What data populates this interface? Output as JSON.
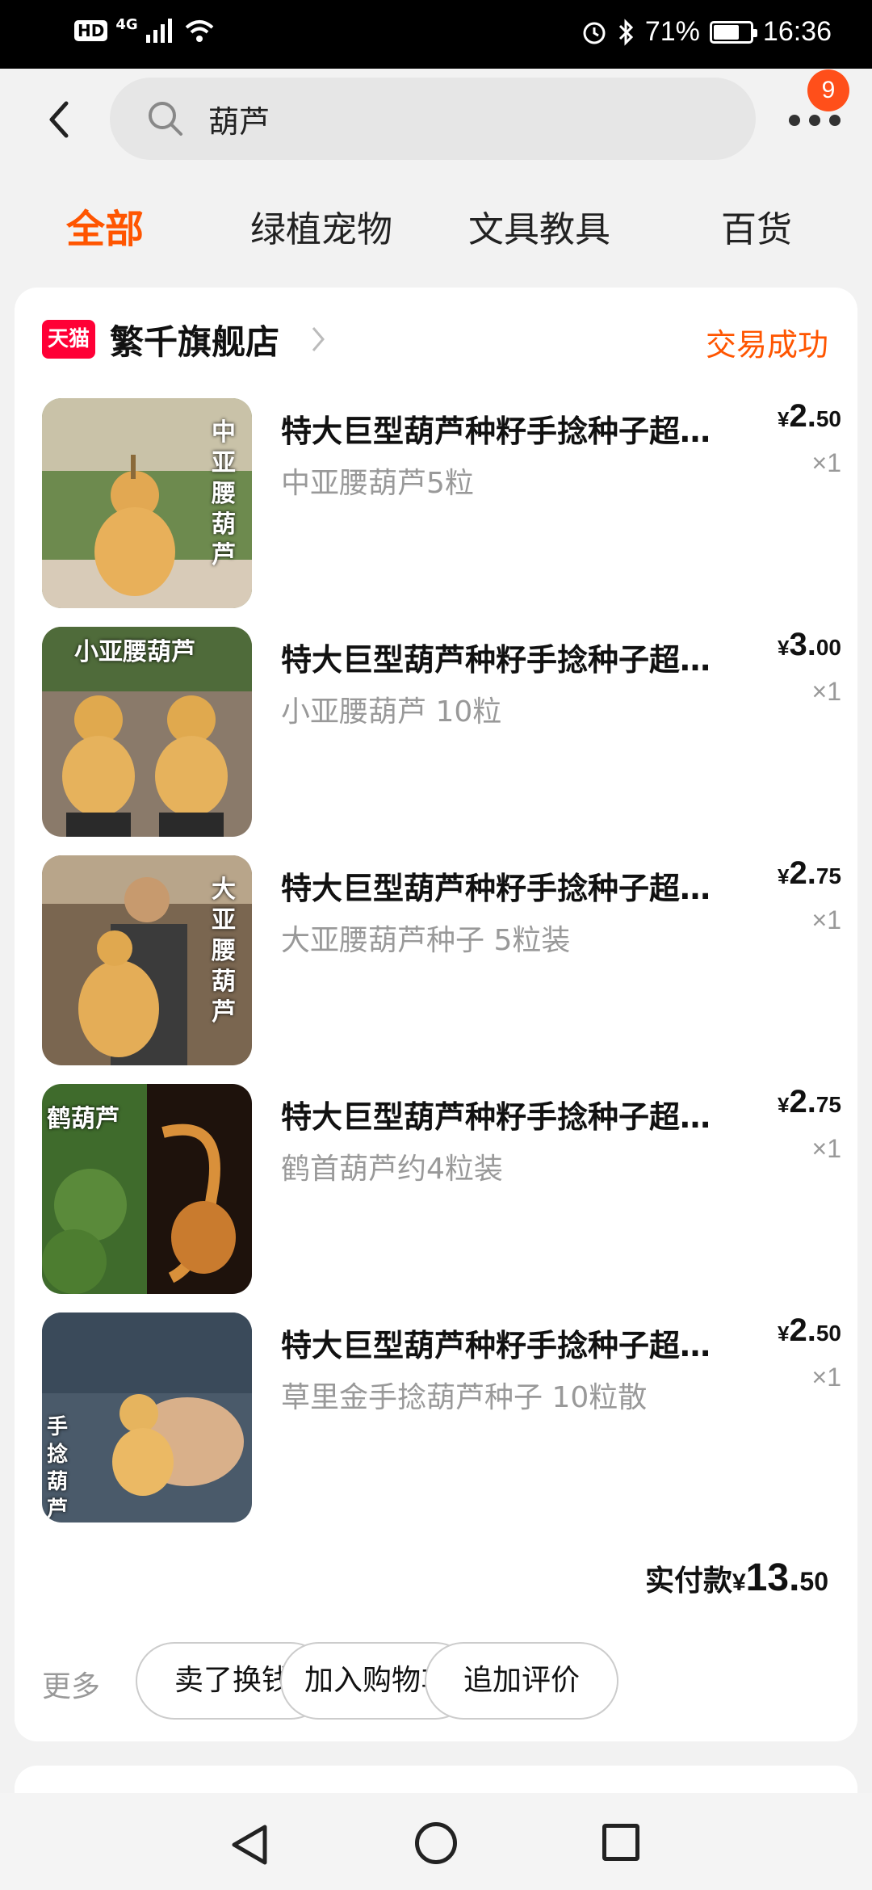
{
  "status_bar": {
    "hd": "HD",
    "network": "4G",
    "battery": "71%",
    "battery_level": 0.71,
    "time": "16:36"
  },
  "header": {
    "search_value": "葫芦",
    "notification_count": "9"
  },
  "tabs": [
    {
      "label": "全部",
      "active": true
    },
    {
      "label": "绿植宠物",
      "active": false
    },
    {
      "label": "文具教具",
      "active": false
    },
    {
      "label": "百货",
      "active": false
    }
  ],
  "order": {
    "shop_logo_text": "天猫",
    "shop_name": "繁千旗舰店",
    "status": "交易成功",
    "items": [
      {
        "title": "特大巨型葫芦种籽手捻种子超…",
        "sku": "中亚腰葫芦5粒",
        "currency": "¥",
        "price_int": "2.",
        "price_dec": "50",
        "qty": "×1",
        "thumb_label": "中亚腰葫芦"
      },
      {
        "title": "特大巨型葫芦种籽手捻种子超…",
        "sku": "小亚腰葫芦 10粒",
        "currency": "¥",
        "price_int": "3.",
        "price_dec": "00",
        "qty": "×1",
        "thumb_label": "小亚腰葫芦"
      },
      {
        "title": "特大巨型葫芦种籽手捻种子超…",
        "sku": "大亚腰葫芦种子 5粒装",
        "currency": "¥",
        "price_int": "2.",
        "price_dec": "75",
        "qty": "×1",
        "thumb_label": "大亚腰葫芦"
      },
      {
        "title": "特大巨型葫芦种籽手捻种子超…",
        "sku": "鹤首葫芦约4粒装",
        "currency": "¥",
        "price_int": "2.",
        "price_dec": "75",
        "qty": "×1",
        "thumb_label": "鹤葫芦"
      },
      {
        "title": "特大巨型葫芦种籽手捻种子超…",
        "sku": "草里金手捻葫芦种子 10粒散",
        "currency": "¥",
        "price_int": "2.",
        "price_dec": "50",
        "qty": "×1",
        "thumb_label": "手捻葫芦"
      }
    ],
    "total_label": "实付款",
    "total_currency": "¥",
    "total_int": "13.",
    "total_dec": "50",
    "more_label": "更多",
    "buttons": {
      "sell": "卖了换钱",
      "add_cart": "加入购物车",
      "review": "追加评价"
    }
  },
  "colors": {
    "accent": "#ff5500",
    "tmall_red": "#ff0036",
    "badge": "#ff4f1a"
  }
}
